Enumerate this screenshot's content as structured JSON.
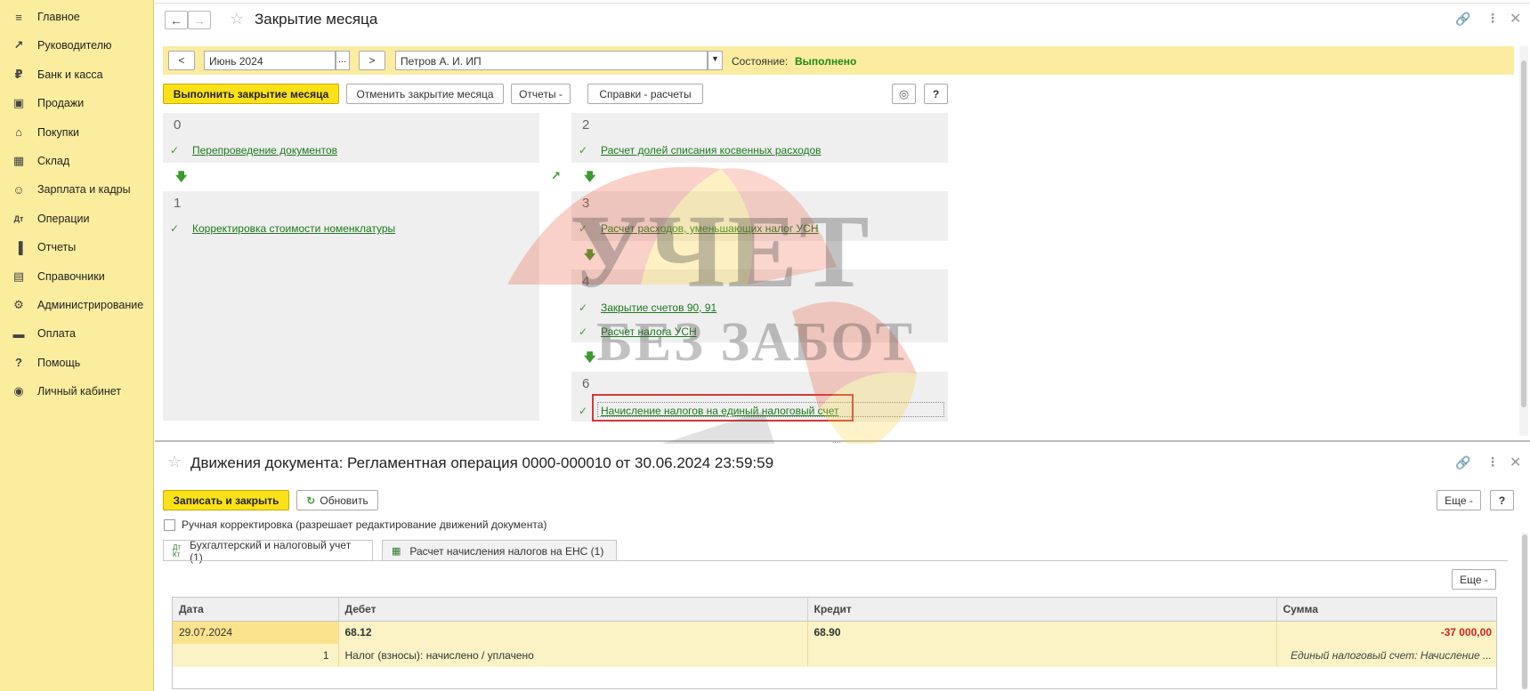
{
  "sidebar": {
    "items": [
      {
        "label": "Главное",
        "icon": "menu-icon"
      },
      {
        "label": "Руководителю",
        "icon": "trend-icon"
      },
      {
        "label": "Банк и касса",
        "icon": "coin-icon"
      },
      {
        "label": "Продажи",
        "icon": "bag-icon"
      },
      {
        "label": "Покупки",
        "icon": "cart-icon"
      },
      {
        "label": "Склад",
        "icon": "warehouse-icon"
      },
      {
        "label": "Зарплата и кадры",
        "icon": "person-icon"
      },
      {
        "label": "Операции",
        "icon": "dt-kt-icon"
      },
      {
        "label": "Отчеты",
        "icon": "bar-chart-icon"
      },
      {
        "label": "Справочники",
        "icon": "books-icon"
      },
      {
        "label": "Администрирование",
        "icon": "gear-icon"
      },
      {
        "label": "Оплата",
        "icon": "card-icon"
      },
      {
        "label": "Помощь",
        "icon": "question-icon"
      },
      {
        "label": "Личный кабинет",
        "icon": "account-icon"
      }
    ]
  },
  "top": {
    "title": "Закрытие месяца",
    "period": "Июнь 2024",
    "period_ellipsis": "...",
    "prev_label": "<",
    "next_label": ">",
    "org": "Петров А. И. ИП",
    "state_label": "Состояние:",
    "state_value": "Выполнено",
    "btn_execute": "Выполнить закрытие месяца",
    "btn_cancel": "Отменить закрытие месяца",
    "btn_reports": "Отчеты -",
    "btn_refs": "Справки - расчеты",
    "btn_help": "?",
    "steps": {
      "s0": {
        "num": "0",
        "links": [
          "Перепроведение документов"
        ]
      },
      "s1": {
        "num": "1",
        "links": [
          "Корректировка стоимости номенклатуры"
        ]
      },
      "s2": {
        "num": "2",
        "links": [
          "Расчет долей списания косвенных расходов"
        ]
      },
      "s3": {
        "num": "3",
        "links": [
          "Расчет расходов, уменьшающих налог УСН"
        ]
      },
      "s4": {
        "num": "4",
        "links": [
          "Закрытие счетов 90, 91",
          "Расчет налога УСН"
        ]
      },
      "s6": {
        "num": "6",
        "links": [
          "Начисление налогов на единый налоговый счет"
        ]
      }
    },
    "resize_hint": "....",
    "watermark_line1": "УЧЕТ",
    "watermark_line2": "БЕЗ ЗАБОТ"
  },
  "bottom": {
    "title": "Движения документа: Регламентная операция 0000-000010 от 30.06.2024 23:59:59",
    "btn_save_close": "Записать и закрыть",
    "btn_refresh": "Обновить",
    "btn_more": "Еще -",
    "btn_help": "?",
    "manual_label": "Ручная корректировка (разрешает редактирование движений документа)",
    "tabs": [
      "Бухгалтерский и налоговый учет (1)",
      "Расчет начисления налогов на ЕНС (1)"
    ],
    "table_more": "Еще -",
    "columns": [
      "Дата",
      "Дебет",
      "Кредит",
      "Сумма"
    ],
    "rows": [
      {
        "date": "29.07.2024",
        "debit": "68.12",
        "credit": "68.90",
        "sum": "-37 000,00",
        "num": "1",
        "debit_sub": "Налог (взносы): начислено / уплачено",
        "sum_sub": "Единый налоговый счет: Начисление ..."
      }
    ]
  }
}
